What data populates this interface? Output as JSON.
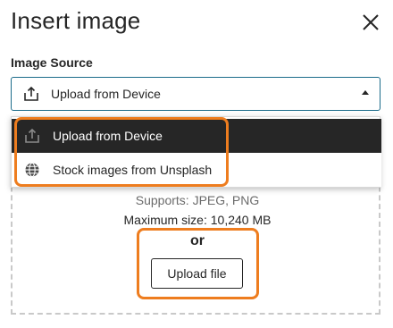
{
  "dialog": {
    "title": "Insert image",
    "close_icon": "close-icon"
  },
  "source": {
    "label": "Image Source",
    "selected": "Upload from Device",
    "options": [
      {
        "label": "Upload from Device",
        "icon": "upload-icon",
        "highlighted": true
      },
      {
        "label": "Stock images from Unsplash",
        "icon": "globe-icon",
        "highlighted": false
      }
    ]
  },
  "dropzone": {
    "supports": "Supports: JPEG, PNG",
    "max_size": "Maximum size: 10,240 MB",
    "or": "or",
    "upload_button": "Upload file"
  },
  "colors": {
    "accent_border": "#1b6b8a",
    "highlight": "#ee7d1f",
    "menu_active_bg": "#262626"
  }
}
